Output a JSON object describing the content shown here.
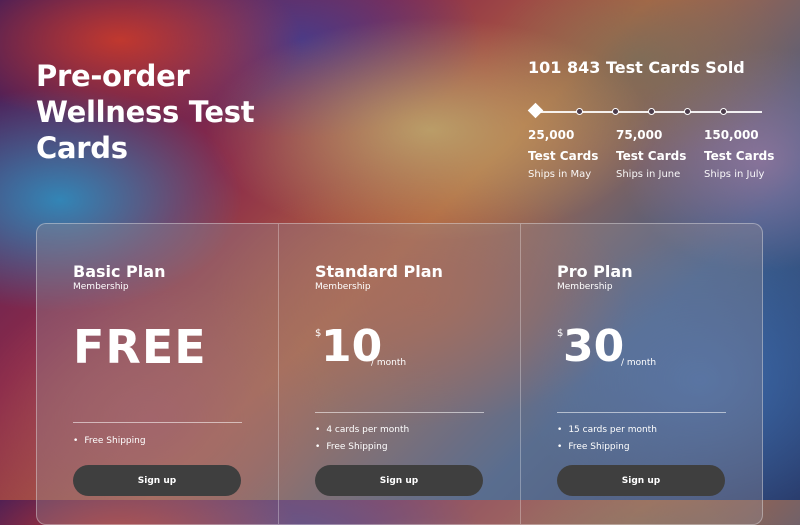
{
  "hero": {
    "title": "Pre-order Wellness Test Cards"
  },
  "progress": {
    "sold_text": "101 843 Test Cards Sold",
    "milestones": [
      {
        "count": "25,000",
        "label": "Test Cards",
        "ships": "Ships in May"
      },
      {
        "count": "75,000",
        "label": "Test Cards",
        "ships": "Ships in June"
      },
      {
        "count": "150,000",
        "label": "Test Cards",
        "ships": "Ships in July"
      }
    ]
  },
  "plans": [
    {
      "title": "Basic Plan",
      "subtitle": "Membership",
      "price": "FREE",
      "features": [
        "Free Shipping"
      ],
      "button": "Sign up"
    },
    {
      "title": "Standard Plan",
      "subtitle": "Membership",
      "currency": "$",
      "amount": "10",
      "period": "/ month",
      "features": [
        "4 cards per month",
        "Free Shipping"
      ],
      "button": "Sign up"
    },
    {
      "title": "Pro Plan",
      "subtitle": "Membership",
      "currency": "$",
      "amount": "30",
      "period": "/ month",
      "features": [
        "15 cards per month",
        "Free Shipping"
      ],
      "button": "Sign up"
    }
  ]
}
